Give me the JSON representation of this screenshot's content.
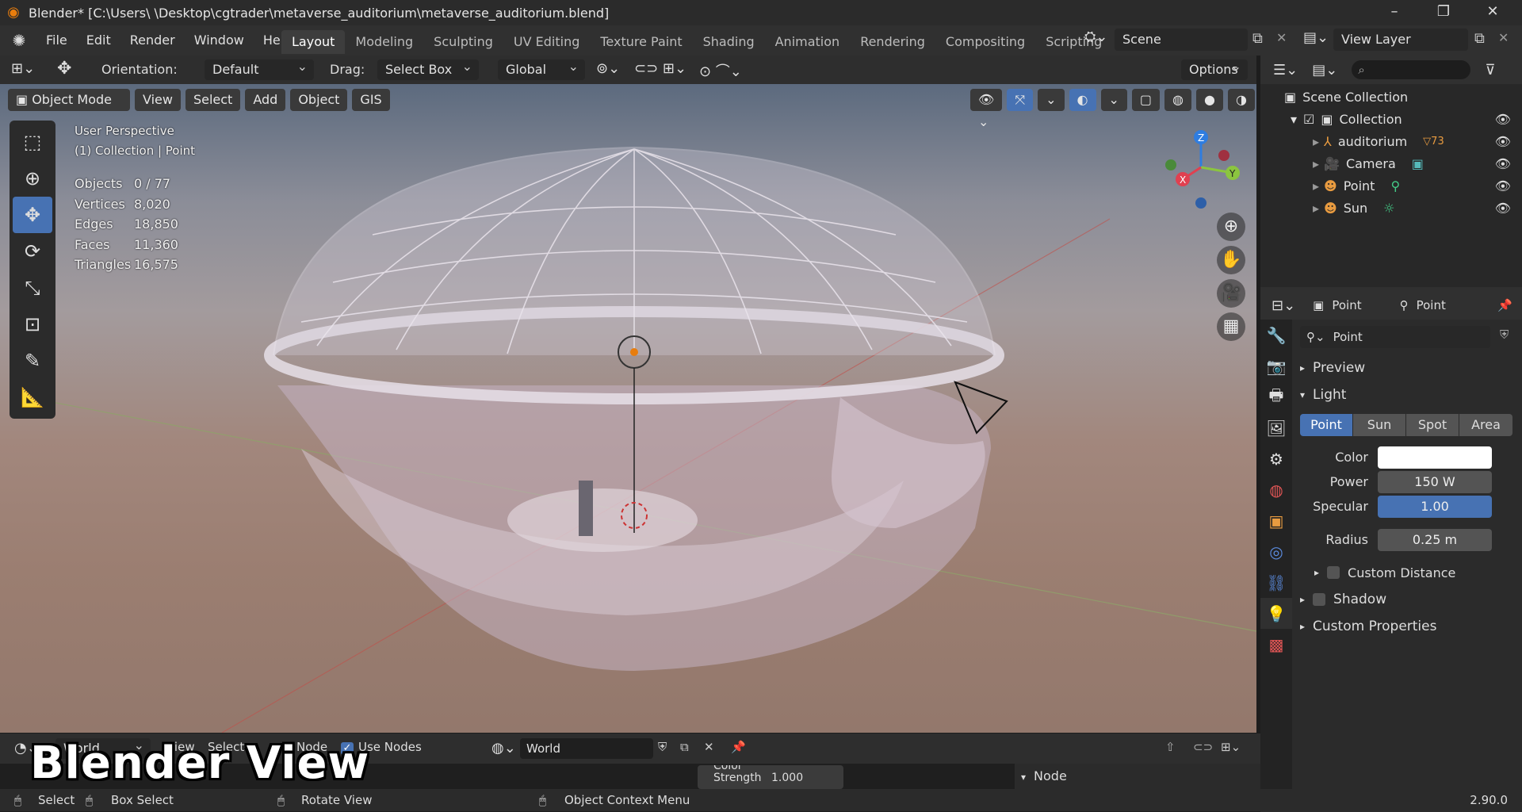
{
  "window": {
    "title": "Blender* [C:\\Users\\        \\Desktop\\cgtrader\\metaverse_auditorium\\metaverse_auditorium.blend]",
    "minimize": "–",
    "maximize": "❐",
    "close": "✕"
  },
  "menu": [
    "File",
    "Edit",
    "Render",
    "Window",
    "Help"
  ],
  "workspaces": [
    "Layout",
    "Modeling",
    "Sculpting",
    "UV Editing",
    "Texture Paint",
    "Shading",
    "Animation",
    "Rendering",
    "Compositing",
    "Scripting"
  ],
  "active_workspace": "Layout",
  "scene": "Scene",
  "view_layer": "View Layer",
  "toolbar": {
    "orientation_label": "Orientation:",
    "orientation_value": "Default",
    "drag_label": "Drag:",
    "drag_value": "Select Box",
    "transform_value": "Global",
    "options": "Options"
  },
  "viewport_header": {
    "mode": "Object Mode",
    "menus": [
      "View",
      "Select",
      "Add",
      "Object",
      "GIS"
    ]
  },
  "viewport_info": {
    "perspective": "User Perspective",
    "collection": "(1) Collection | Point"
  },
  "stats": [
    {
      "k": "Objects",
      "v": "0 / 77"
    },
    {
      "k": "Vertices",
      "v": "8,020"
    },
    {
      "k": "Edges",
      "v": "18,850"
    },
    {
      "k": "Faces",
      "v": "11,360"
    },
    {
      "k": "Triangles",
      "v": "16,575"
    }
  ],
  "gizmo": {
    "z": "Z",
    "y": "Y",
    "x": "X"
  },
  "outliner": {
    "root": "Scene Collection",
    "collection": "Collection",
    "items": [
      {
        "name": "auditorium",
        "badge": "73"
      },
      {
        "name": "Camera"
      },
      {
        "name": "Point"
      },
      {
        "name": "Sun"
      }
    ]
  },
  "properties": {
    "object_name": "Point",
    "data_name": "Point",
    "light_name": "Point",
    "sections": {
      "preview": "Preview",
      "light": "Light",
      "custom_distance": "Custom Distance",
      "shadow": "Shadow",
      "custom_properties": "Custom Properties"
    },
    "light_types": [
      "Point",
      "Sun",
      "Spot",
      "Area"
    ],
    "active_type": "Point",
    "fields": [
      {
        "label": "Color",
        "value": ""
      },
      {
        "label": "Power",
        "value": "150 W"
      },
      {
        "label": "Specular",
        "value": "1.00"
      },
      {
        "label": "Radius",
        "value": "0.25 m"
      }
    ],
    "color_value": "#ffffff"
  },
  "node_editor": {
    "world_label": "World",
    "use_nodes": "Use Nodes",
    "world_name": "World",
    "node_panel": "Node",
    "strength_label": "Strength",
    "strength_value": "1.000",
    "color_label": "Color",
    "view_label": "View",
    "select_label": "Select",
    "node_label": "Node"
  },
  "status": {
    "select": "Select",
    "box_select": "Box Select",
    "rotate": "Rotate View",
    "context": "Object Context Menu",
    "version": "2.90.0"
  },
  "caption": "Blender View"
}
